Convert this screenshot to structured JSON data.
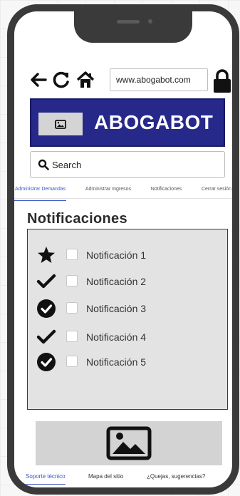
{
  "browser": {
    "url": "www.abogabot.com",
    "icons": [
      "back-arrow-icon",
      "refresh-icon",
      "home-icon",
      "lock-icon"
    ]
  },
  "header": {
    "brand": "ABOGABOT",
    "logo_icon": "image-placeholder-icon",
    "background_color": "#26288a"
  },
  "search": {
    "placeholder": "Search",
    "icon": "search-icon"
  },
  "tabs": [
    {
      "label": "Administrar Demandas",
      "active": true
    },
    {
      "label": "Administrar Ingresos",
      "active": false
    },
    {
      "label": "Notificaciones",
      "active": false
    },
    {
      "label": "Cerrar sesión",
      "active": false
    }
  ],
  "page_title": "Notificaciones",
  "notifications": [
    {
      "label": "Notificación 1",
      "icon": "star-icon",
      "checked": false
    },
    {
      "label": "Notificación 2",
      "icon": "checkmark-icon",
      "checked": false
    },
    {
      "label": "Notificación 3",
      "icon": "check-circle-icon",
      "checked": false
    },
    {
      "label": "Notificación 4",
      "icon": "checkmark-icon",
      "checked": false
    },
    {
      "label": "Notificación 5",
      "icon": "check-circle-icon",
      "checked": false
    }
  ],
  "footer": {
    "image_icon": "image-placeholder-icon",
    "links": [
      {
        "label": "Soporte técnico",
        "active": true
      },
      {
        "label": "Mapa del sitio",
        "active": false
      },
      {
        "label": "¿Quejas, sugerencias?",
        "active": false
      }
    ]
  },
  "colors": {
    "accent": "#3a56c6",
    "panel": "#e3e3e3"
  }
}
